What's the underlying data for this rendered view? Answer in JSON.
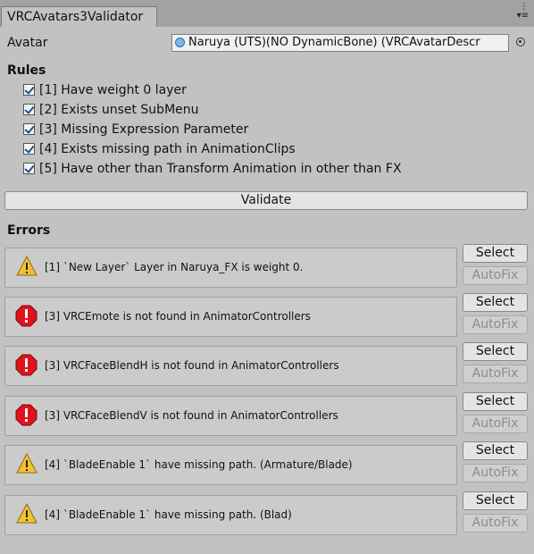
{
  "window": {
    "tab_title": "VRCAvatars3Validator"
  },
  "avatar": {
    "label": "Avatar",
    "value": "Naruya (UTS)(NO DynamicBone) (VRCAvatarDescr"
  },
  "rules": {
    "title": "Rules",
    "items": [
      {
        "label": "[1] Have weight 0 layer",
        "checked": true
      },
      {
        "label": "[2] Exists unset SubMenu",
        "checked": true
      },
      {
        "label": "[3] Missing Expression Parameter",
        "checked": true
      },
      {
        "label": "[4] Exists missing path in AnimationClips",
        "checked": true
      },
      {
        "label": "[5] Have other than Transform Animation in other than FX",
        "checked": true
      }
    ]
  },
  "validate_label": "Validate",
  "errors": {
    "title": "Errors",
    "select_label": "Select",
    "autofix_label": "AutoFix",
    "items": [
      {
        "type": "warning",
        "message": "[1] `New Layer` Layer in Naruya_FX is weight 0."
      },
      {
        "type": "error",
        "message": "[3] VRCEmote is not found in AnimatorControllers"
      },
      {
        "type": "error",
        "message": "[3] VRCFaceBlendH is not found in AnimatorControllers"
      },
      {
        "type": "error",
        "message": "[3] VRCFaceBlendV is not found in AnimatorControllers"
      },
      {
        "type": "warning",
        "message": "[4] `BladeEnable 1` have missing path. (Armature/Blade)"
      },
      {
        "type": "warning",
        "message": "[4] `BladeEnable 1` have missing path. (Blad)"
      }
    ]
  },
  "colors": {
    "warning": "#f2c230",
    "error": "#e0121b",
    "panel": "#c2c2c2"
  }
}
